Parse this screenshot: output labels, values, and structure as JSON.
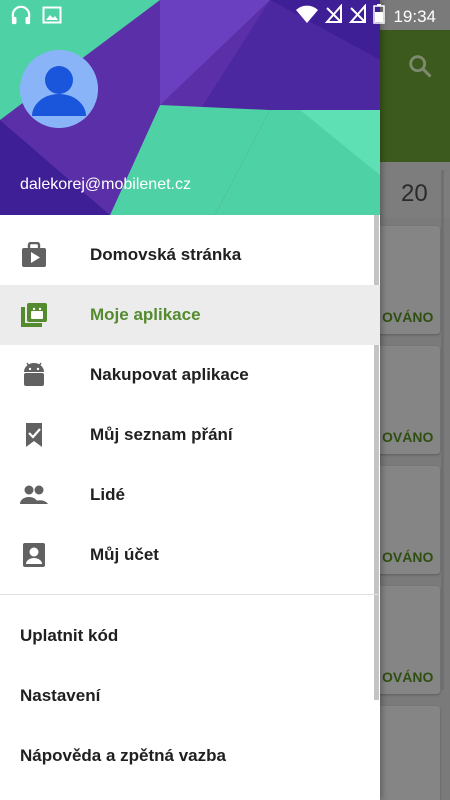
{
  "status_bar": {
    "time": "19:34",
    "left_icons": [
      "headphones-icon",
      "image-icon"
    ],
    "right_icons": [
      "wifi-icon",
      "no-signal-icon",
      "no-signal-icon",
      "battery-icon"
    ]
  },
  "drawer": {
    "account_email": "dalekorej@mobilenet.cz",
    "primary_items": [
      {
        "label": "Domovská stránka",
        "icon": "play-store-bag-icon",
        "active": false
      },
      {
        "label": "Moje aplikace",
        "icon": "my-apps-icon",
        "active": true
      },
      {
        "label": "Nakupovat aplikace",
        "icon": "android-icon",
        "active": false
      },
      {
        "label": "Můj seznam přání",
        "icon": "wishlist-bookmark-icon",
        "active": false
      },
      {
        "label": "Lidé",
        "icon": "people-icon",
        "active": false
      },
      {
        "label": "Můj účet",
        "icon": "account-box-icon",
        "active": false
      }
    ],
    "secondary_items": [
      {
        "label": "Uplatnit kód"
      },
      {
        "label": "Nastavení"
      },
      {
        "label": "Nápověda a zpětná vazba"
      }
    ]
  },
  "background": {
    "tab_count": "20",
    "card_button_label": "OVÁNO"
  },
  "colors": {
    "accent_green": "#558b2f",
    "header_purple": "#5a2fa8",
    "header_teal": "#4fd1a6"
  }
}
